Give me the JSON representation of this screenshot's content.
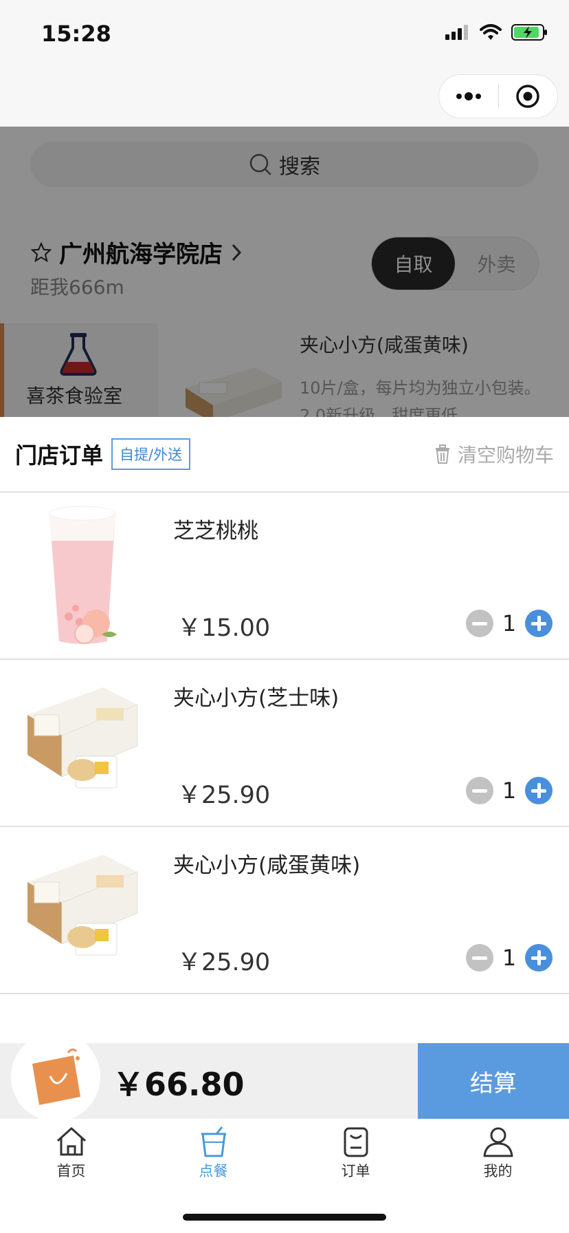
{
  "status_bar": {
    "time": "15:28"
  },
  "search": {
    "placeholder": "搜索"
  },
  "store": {
    "name": "广州航海学院店",
    "distance": "距我666m"
  },
  "mode_toggle": {
    "options": [
      "自取",
      "外卖"
    ],
    "selected": "自取"
  },
  "background_list": {
    "category_label": "喜茶食验室",
    "product_title": "夹心小方(咸蛋黄味)",
    "product_desc": "10片/盒，每片均为独立小包装。2.0新升级，甜度更低。..."
  },
  "cart": {
    "title": "门店订单",
    "tag": "自提/外送",
    "clear_label": "清空购物车",
    "items": [
      {
        "name": "芝芝桃桃",
        "price": "￥15.00",
        "quantity": "1"
      },
      {
        "name": "夹心小方(芝士味)",
        "price": "￥25.90",
        "quantity": "1"
      },
      {
        "name": "夹心小方(咸蛋黄味)",
        "price": "￥25.90",
        "quantity": "1"
      }
    ]
  },
  "checkout": {
    "total": "￥66.80",
    "button_label": "结算"
  },
  "tabbar": {
    "items": [
      {
        "label": "首页",
        "icon": "home-icon"
      },
      {
        "label": "点餐",
        "icon": "cup-icon",
        "active": true
      },
      {
        "label": "订单",
        "icon": "order-icon"
      },
      {
        "label": "我的",
        "icon": "user-icon"
      }
    ]
  },
  "colors": {
    "accent": "#5a9be0",
    "tab_active": "#4a98d8",
    "bag": "#e8914e"
  }
}
